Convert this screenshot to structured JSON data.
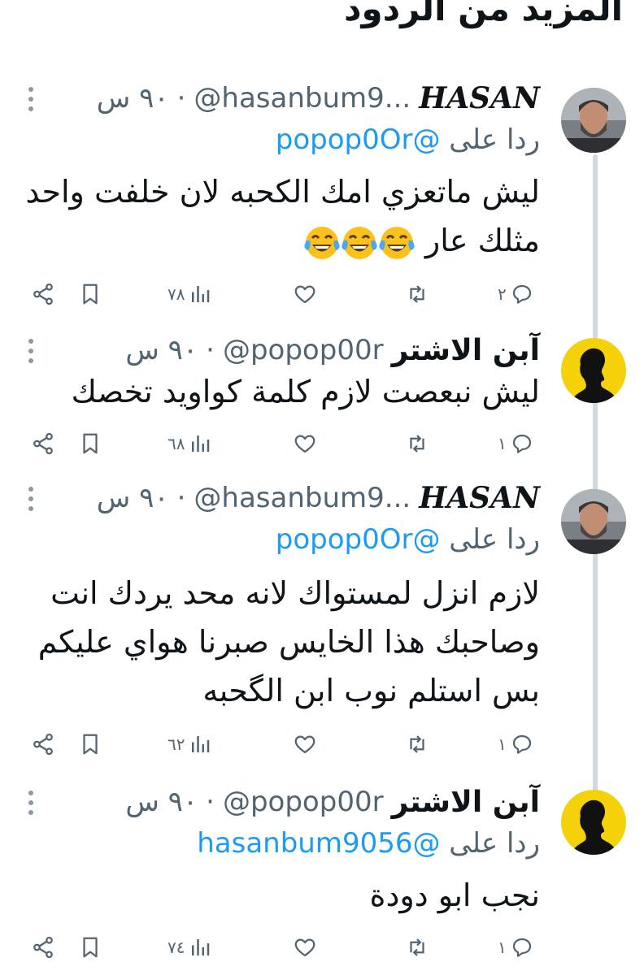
{
  "section_title": "المزيد من الردود",
  "reply_prefix": "ردا على",
  "tweets": [
    {
      "name": "HASAN",
      "handle": "@hasanbum9...",
      "time": "٩٠ س",
      "reply_to": "@popop0Or",
      "text": "ليش ماتعزي امك الكحبه لان خلفت واحد\nمثلك عار",
      "emojis": [
        "face-with-tears-of-joy",
        "face-with-tears-of-joy",
        "face-with-tears-of-joy"
      ],
      "replies": "٢",
      "likes": "",
      "views": "٧٨"
    },
    {
      "name": "آبن الاشتر",
      "handle": "@popop00r",
      "time": "٩٠ س",
      "reply_to": "",
      "text": "ليش نبعصت لازم كلمة كواويد تخصك",
      "emojis": [],
      "replies": "١",
      "likes": "",
      "views": "٦٨"
    },
    {
      "name": "HASAN",
      "handle": "@hasanbum9...",
      "time": "٩٠ س",
      "reply_to": "@popop0Or",
      "text": "لازم انزل لمستواك لانه محد يردك انت\nوصاحبك هذا الخايس صبرنا هواي عليكم\nبس استلم نوب ابن الگحبه",
      "emojis": [],
      "replies": "١",
      "likes": "",
      "views": "٦٢"
    },
    {
      "name": "آبن الاشتر",
      "handle": "@popop00r",
      "time": "٩٠ س",
      "reply_to": "@hasanbum9056",
      "text": "نجب ابو دودة",
      "emojis": [],
      "replies": "١",
      "likes": "",
      "views": "٧٤"
    }
  ],
  "colors": {
    "text": "#0f1419",
    "muted": "#536471",
    "link": "#1d9bf0",
    "thread_line": "#cfd9de",
    "avatar_bg_yellow": "#f5d10a"
  }
}
